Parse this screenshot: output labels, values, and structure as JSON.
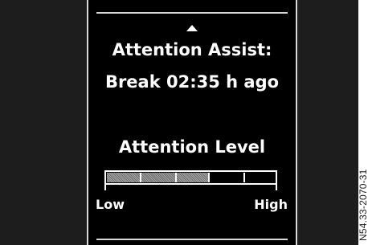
{
  "display": {
    "title": "Attention Assist:",
    "status": "Break 02:35 h ago",
    "level_heading": "Attention Level",
    "scale_low": "Low",
    "scale_high": "High",
    "up_arrow": "up-arrow-icon"
  },
  "attention_level": {
    "fill_fraction": 0.61
  },
  "figure_id": "N54.33-2070-31",
  "colors": {
    "background": "#000000",
    "side_background": "#1d1d1d",
    "text": "#ffffff",
    "bar_fill": "#8a8a8a"
  }
}
